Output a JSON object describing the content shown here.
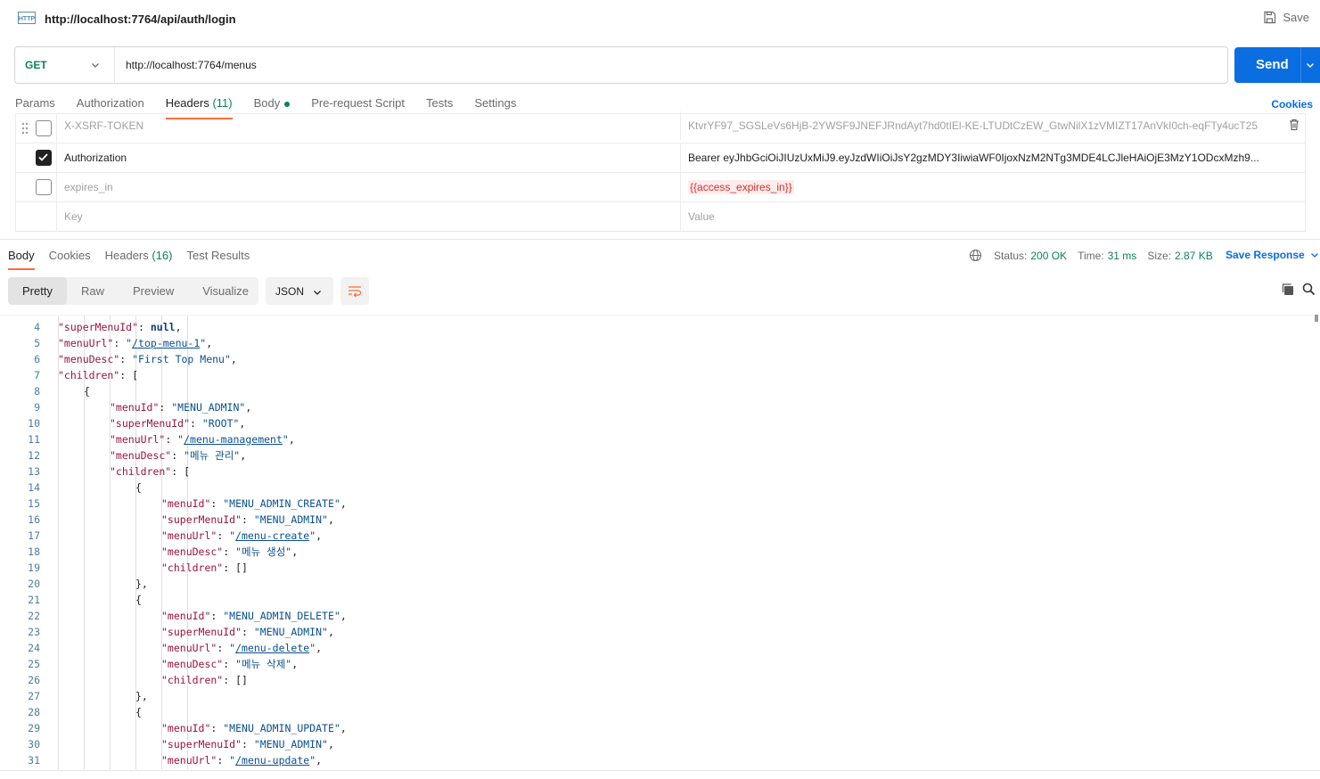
{
  "top": {
    "tab_title": "http://localhost:7764/api/auth/login",
    "save_label": "Save"
  },
  "request": {
    "method": "GET",
    "url": "http://localhost:7764/menus",
    "send_label": "Send",
    "cookies_label": "Cookies",
    "tabs": {
      "params": "Params",
      "authorization": "Authorization",
      "headers": "Headers",
      "headers_count": "(11)",
      "body": "Body",
      "prerequest": "Pre-request Script",
      "tests": "Tests",
      "settings": "Settings"
    },
    "headers": [
      {
        "key": "X-XSRF-TOKEN",
        "value": "KtvrYF97_SGSLeVs6HjB-2YWSF9JNEFJRndAyt7hd0tIEl-KE-LTUDtCzEW_GtwNilX1zVMIZT17AnVkI0ch-eqFTy4ucT25",
        "checked": false
      },
      {
        "key": "Authorization",
        "value": "Bearer eyJhbGciOiJIUzUxMiJ9.eyJzdWIiOiJsY2gzMDY3IiwiaWF0IjoxNzM2NTg3MDE4LCJleHAiOjE3MzY1ODcxMzh9...",
        "checked": true
      },
      {
        "key": "expires_in",
        "value": "{{access_expires_in}}",
        "checked": false
      }
    ],
    "key_placeholder": "Key",
    "value_placeholder": "Value"
  },
  "response": {
    "tabs": {
      "body": "Body",
      "cookies": "Cookies",
      "headers": "Headers",
      "headers_count": "(16)",
      "test_results": "Test Results"
    },
    "status_label": "Status:",
    "status_value": "200 OK",
    "time_label": "Time:",
    "time_value": "31 ms",
    "size_label": "Size:",
    "size_value": "2.87 KB",
    "save_response_label": "Save Response",
    "view_modes": [
      "Pretty",
      "Raw",
      "Preview",
      "Visualize"
    ],
    "format": "JSON",
    "lines": [
      {
        "n": "4",
        "indent": 2,
        "parts": [
          [
            "k",
            "\"superMenuId\""
          ],
          [
            "p",
            ": "
          ],
          [
            "n",
            "null"
          ],
          [
            "p",
            ","
          ]
        ]
      },
      {
        "n": "5",
        "indent": 2,
        "parts": [
          [
            "k",
            "\"menuUrl\""
          ],
          [
            "p",
            ": "
          ],
          [
            "s",
            "\""
          ],
          [
            "u",
            "/top-menu-1"
          ],
          [
            "s",
            "\""
          ],
          [
            "p",
            ","
          ]
        ]
      },
      {
        "n": "6",
        "indent": 2,
        "parts": [
          [
            "k",
            "\"menuDesc\""
          ],
          [
            "p",
            ": "
          ],
          [
            "s",
            "\"First Top Menu\""
          ],
          [
            "p",
            ","
          ]
        ]
      },
      {
        "n": "7",
        "indent": 2,
        "parts": [
          [
            "k",
            "\"children\""
          ],
          [
            "p",
            ": ["
          ]
        ]
      },
      {
        "n": "8",
        "indent": 3,
        "parts": [
          [
            "p",
            "{"
          ]
        ]
      },
      {
        "n": "9",
        "indent": 4,
        "parts": [
          [
            "k",
            "\"menuId\""
          ],
          [
            "p",
            ": "
          ],
          [
            "s",
            "\"MENU_ADMIN\""
          ],
          [
            "p",
            ","
          ]
        ]
      },
      {
        "n": "10",
        "indent": 4,
        "parts": [
          [
            "k",
            "\"superMenuId\""
          ],
          [
            "p",
            ": "
          ],
          [
            "s",
            "\"ROOT\""
          ],
          [
            "p",
            ","
          ]
        ]
      },
      {
        "n": "11",
        "indent": 4,
        "parts": [
          [
            "k",
            "\"menuUrl\""
          ],
          [
            "p",
            ": "
          ],
          [
            "s",
            "\""
          ],
          [
            "u",
            "/menu-management"
          ],
          [
            "s",
            "\""
          ],
          [
            "p",
            ","
          ]
        ]
      },
      {
        "n": "12",
        "indent": 4,
        "parts": [
          [
            "k",
            "\"menuDesc\""
          ],
          [
            "p",
            ": "
          ],
          [
            "s",
            "\"메뉴 관리\""
          ],
          [
            "p",
            ","
          ]
        ]
      },
      {
        "n": "13",
        "indent": 4,
        "parts": [
          [
            "k",
            "\"children\""
          ],
          [
            "p",
            ": ["
          ]
        ]
      },
      {
        "n": "14",
        "indent": 5,
        "parts": [
          [
            "p",
            "{"
          ]
        ]
      },
      {
        "n": "15",
        "indent": 6,
        "parts": [
          [
            "k",
            "\"menuId\""
          ],
          [
            "p",
            ": "
          ],
          [
            "s",
            "\"MENU_ADMIN_CREATE\""
          ],
          [
            "p",
            ","
          ]
        ]
      },
      {
        "n": "16",
        "indent": 6,
        "parts": [
          [
            "k",
            "\"superMenuId\""
          ],
          [
            "p",
            ": "
          ],
          [
            "s",
            "\"MENU_ADMIN\""
          ],
          [
            "p",
            ","
          ]
        ]
      },
      {
        "n": "17",
        "indent": 6,
        "parts": [
          [
            "k",
            "\"menuUrl\""
          ],
          [
            "p",
            ": "
          ],
          [
            "s",
            "\""
          ],
          [
            "u",
            "/menu-create"
          ],
          [
            "s",
            "\""
          ],
          [
            "p",
            ","
          ]
        ]
      },
      {
        "n": "18",
        "indent": 6,
        "parts": [
          [
            "k",
            "\"menuDesc\""
          ],
          [
            "p",
            ": "
          ],
          [
            "s",
            "\"메뉴 생성\""
          ],
          [
            "p",
            ","
          ]
        ]
      },
      {
        "n": "19",
        "indent": 6,
        "parts": [
          [
            "k",
            "\"children\""
          ],
          [
            "p",
            ": []"
          ]
        ]
      },
      {
        "n": "20",
        "indent": 5,
        "parts": [
          [
            "p",
            "},"
          ]
        ]
      },
      {
        "n": "21",
        "indent": 5,
        "parts": [
          [
            "p",
            "{"
          ]
        ]
      },
      {
        "n": "22",
        "indent": 6,
        "parts": [
          [
            "k",
            "\"menuId\""
          ],
          [
            "p",
            ": "
          ],
          [
            "s",
            "\"MENU_ADMIN_DELETE\""
          ],
          [
            "p",
            ","
          ]
        ]
      },
      {
        "n": "23",
        "indent": 6,
        "parts": [
          [
            "k",
            "\"superMenuId\""
          ],
          [
            "p",
            ": "
          ],
          [
            "s",
            "\"MENU_ADMIN\""
          ],
          [
            "p",
            ","
          ]
        ]
      },
      {
        "n": "24",
        "indent": 6,
        "parts": [
          [
            "k",
            "\"menuUrl\""
          ],
          [
            "p",
            ": "
          ],
          [
            "s",
            "\""
          ],
          [
            "u",
            "/menu-delete"
          ],
          [
            "s",
            "\""
          ],
          [
            "p",
            ","
          ]
        ]
      },
      {
        "n": "25",
        "indent": 6,
        "parts": [
          [
            "k",
            "\"menuDesc\""
          ],
          [
            "p",
            ": "
          ],
          [
            "s",
            "\"메뉴 삭제\""
          ],
          [
            "p",
            ","
          ]
        ]
      },
      {
        "n": "26",
        "indent": 6,
        "parts": [
          [
            "k",
            "\"children\""
          ],
          [
            "p",
            ": []"
          ]
        ]
      },
      {
        "n": "27",
        "indent": 5,
        "parts": [
          [
            "p",
            "},"
          ]
        ]
      },
      {
        "n": "28",
        "indent": 5,
        "parts": [
          [
            "p",
            "{"
          ]
        ]
      },
      {
        "n": "29",
        "indent": 6,
        "parts": [
          [
            "k",
            "\"menuId\""
          ],
          [
            "p",
            ": "
          ],
          [
            "s",
            "\"MENU_ADMIN_UPDATE\""
          ],
          [
            "p",
            ","
          ]
        ]
      },
      {
        "n": "30",
        "indent": 6,
        "parts": [
          [
            "k",
            "\"superMenuId\""
          ],
          [
            "p",
            ": "
          ],
          [
            "s",
            "\"MENU_ADMIN\""
          ],
          [
            "p",
            ","
          ]
        ]
      },
      {
        "n": "31",
        "indent": 6,
        "parts": [
          [
            "k",
            "\"menuUrl\""
          ],
          [
            "p",
            ": "
          ],
          [
            "s",
            "\""
          ],
          [
            "u",
            "/menu-update"
          ],
          [
            "s",
            "\""
          ],
          [
            "p",
            ","
          ]
        ]
      }
    ]
  },
  "colors": {
    "accent_tab": "#ff6c37",
    "send_button": "#0a6de0",
    "status_green": "#0b8457",
    "json_key": "#98153d",
    "json_string": "#0b4f8f"
  },
  "icons": [
    "http-icon",
    "save-icon",
    "chevron-down-icon",
    "drag-handle-icon",
    "trash-icon",
    "globe-icon",
    "wrap-icon",
    "copy-icon",
    "search-icon"
  ]
}
